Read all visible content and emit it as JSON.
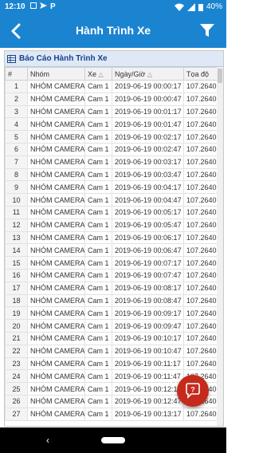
{
  "status_bar": {
    "time": "12:10",
    "battery": "40%"
  },
  "app_bar": {
    "title": "Hành Trình Xe"
  },
  "panel": {
    "title": "Báo Cáo Hành Trình Xe"
  },
  "table": {
    "columns": [
      "#",
      "Nhóm",
      "Xe",
      "Ngày/Giờ",
      "Tọa độ"
    ],
    "rows": [
      [
        "1",
        "NHÓM CAMERA",
        "Cam 1",
        "2019-06-19 00:00:17",
        "107.2640"
      ],
      [
        "2",
        "NHÓM CAMERA",
        "Cam 1",
        "2019-06-19 00:00:47",
        "107.2640"
      ],
      [
        "3",
        "NHÓM CAMERA",
        "Cam 1",
        "2019-06-19 00:01:17",
        "107.2640"
      ],
      [
        "4",
        "NHÓM CAMERA",
        "Cam 1",
        "2019-06-19 00:01:47",
        "107.2640"
      ],
      [
        "5",
        "NHÓM CAMERA",
        "Cam 1",
        "2019-06-19 00:02:17",
        "107.2640"
      ],
      [
        "6",
        "NHÓM CAMERA",
        "Cam 1",
        "2019-06-19 00:02:47",
        "107.2640"
      ],
      [
        "7",
        "NHÓM CAMERA",
        "Cam 1",
        "2019-06-19 00:03:17",
        "107.2640"
      ],
      [
        "8",
        "NHÓM CAMERA",
        "Cam 1",
        "2019-06-19 00:03:47",
        "107.2640"
      ],
      [
        "9",
        "NHÓM CAMERA",
        "Cam 1",
        "2019-06-19 00:04:17",
        "107.2640"
      ],
      [
        "10",
        "NHÓM CAMERA",
        "Cam 1",
        "2019-06-19 00:04:47",
        "107.2640"
      ],
      [
        "11",
        "NHÓM CAMERA",
        "Cam 1",
        "2019-06-19 00:05:17",
        "107.2640"
      ],
      [
        "12",
        "NHÓM CAMERA",
        "Cam 1",
        "2019-06-19 00:05:47",
        "107.2640"
      ],
      [
        "13",
        "NHÓM CAMERA",
        "Cam 1",
        "2019-06-19 00:06:17",
        "107.2640"
      ],
      [
        "14",
        "NHÓM CAMERA",
        "Cam 1",
        "2019-06-19 00:06:47",
        "107.2640"
      ],
      [
        "15",
        "NHÓM CAMERA",
        "Cam 1",
        "2019-06-19 00:07:17",
        "107.2640"
      ],
      [
        "16",
        "NHÓM CAMERA",
        "Cam 1",
        "2019-06-19 00:07:47",
        "107.2640"
      ],
      [
        "17",
        "NHÓM CAMERA",
        "Cam 1",
        "2019-06-19 00:08:17",
        "107.2640"
      ],
      [
        "18",
        "NHÓM CAMERA",
        "Cam 1",
        "2019-06-19 00:08:47",
        "107.2640"
      ],
      [
        "19",
        "NHÓM CAMERA",
        "Cam 1",
        "2019-06-19 00:09:17",
        "107.2640"
      ],
      [
        "20",
        "NHÓM CAMERA",
        "Cam 1",
        "2019-06-19 00:09:47",
        "107.2640"
      ],
      [
        "21",
        "NHÓM CAMERA",
        "Cam 1",
        "2019-06-19 00:10:17",
        "107.2640"
      ],
      [
        "22",
        "NHÓM CAMERA",
        "Cam 1",
        "2019-06-19 00:10:47",
        "107.2640"
      ],
      [
        "23",
        "NHÓM CAMERA",
        "Cam 1",
        "2019-06-19 00:11:17",
        "107.2640"
      ],
      [
        "24",
        "NHÓM CAMERA",
        "Cam 1",
        "2019-06-19 00:11:47",
        "107.2640"
      ],
      [
        "25",
        "NHÓM CAMERA",
        "Cam 1",
        "2019-06-19 00:12:17",
        "107.2640"
      ],
      [
        "26",
        "NHÓM CAMERA",
        "Cam 1",
        "2019-06-19 00:12:47",
        "107.2640"
      ],
      [
        "27",
        "NHÓM CAMERA",
        "Cam 1",
        "2019-06-19 00:13:17",
        "107.2640"
      ]
    ]
  },
  "colors": {
    "primary": "#1b84d1",
    "fab": "#c62a1d",
    "panel_header": "#dfe8f6"
  },
  "icons": {
    "back": "arrow-left-icon",
    "filter": "filter-icon",
    "table": "table-grid-icon",
    "fab": "chat-help-icon"
  }
}
